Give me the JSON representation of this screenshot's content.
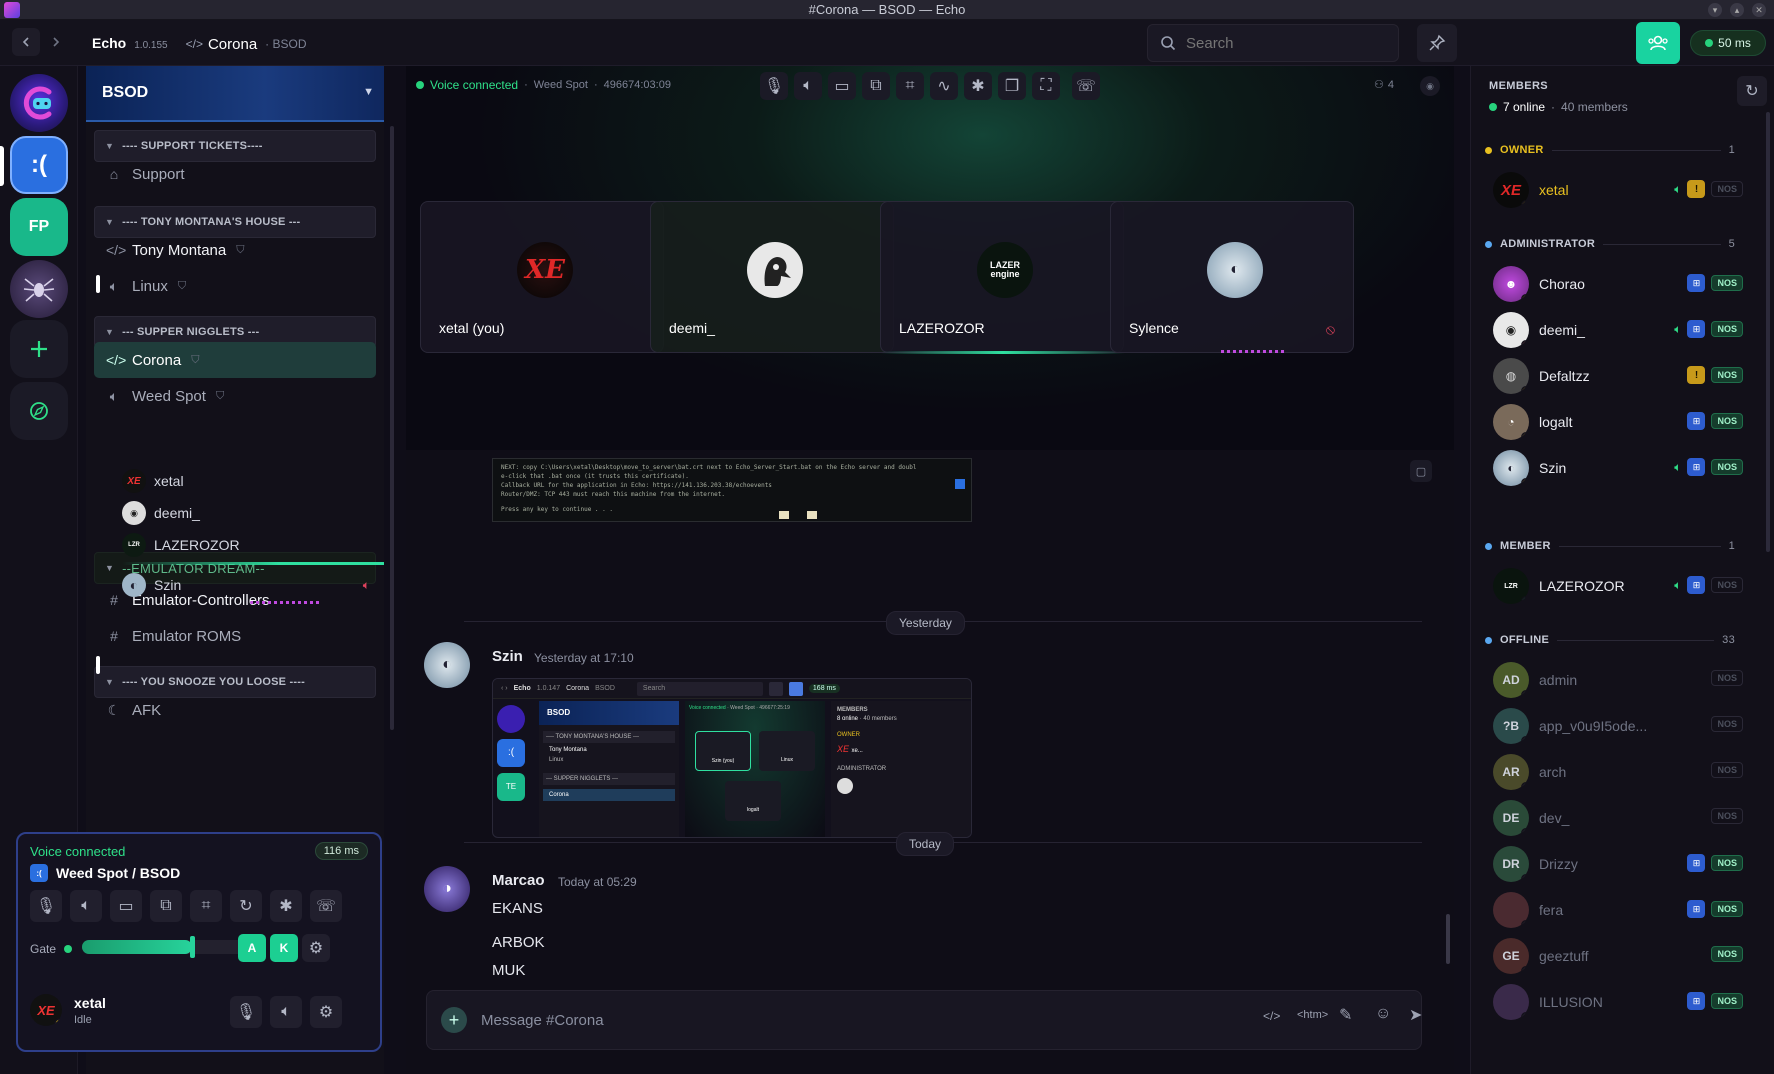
{
  "window": {
    "title": "#Corona — BSOD — Echo"
  },
  "header": {
    "app_name": "Echo",
    "version": "1.0.155",
    "channel": "Corona",
    "server": "BSOD",
    "search_placeholder": "Search",
    "ping": "50 ms"
  },
  "rail": {
    "servers": [
      ":(",
      "FP"
    ]
  },
  "server": {
    "name": "BSOD"
  },
  "channels": {
    "cat_support": "---- SUPPORT TICKETS----",
    "ch_support": "Support",
    "cat_tony": "---- TONY MONTANA'S HOUSE ---",
    "ch_tony": "Tony Montana",
    "ch_linux": "Linux",
    "cat_supper": "--- SUPPER NIGGLETS ---",
    "ch_corona": "Corona",
    "ch_weed": "Weed Spot",
    "voice_users": [
      "xetal",
      "deemi_",
      "LAZEROZOR",
      "Szin"
    ],
    "cat_emulator": "--EMULATOR DREAM--",
    "ch_emu_ctrl": "Emulator-Controllers",
    "ch_emu_roms": "Emulator ROMS",
    "cat_snooze": "---- YOU SNOOZE YOU LOOSE ----",
    "ch_afk": "AFK"
  },
  "voice_panel": {
    "status": "Voice connected",
    "ping": "116 ms",
    "channel": "Weed Spot / BSOD",
    "gate_label": "Gate",
    "gate_level": 0.62,
    "key_a": "A",
    "key_k": "K",
    "user_name": "xetal",
    "user_status": "Idle"
  },
  "stage": {
    "status": "Voice connected",
    "channel": "Weed Spot",
    "duration": "496674:03:09",
    "participants_count": "4",
    "tiles": [
      "xetal (you)",
      "deemi_",
      "LAZEROZOR",
      "Sylence"
    ],
    "lazer_logo": "LAZER engine"
  },
  "terminal_preview": {
    "lines": [
      "NEXT: copy  C:\\Users\\xetal\\Desktop\\move_to_server\\bat.crt  next to Echo_Server_Start.bat on the Echo server and doubl",
      "e-click that .bat once (it trusts this certificate).",
      "  Callback URL for the application in Echo:  https://141.136.203.38/echoevents",
      "  Router/DMZ: TCP 443 must reach this machine from the internet.",
      "Press any key to continue . . ."
    ]
  },
  "messages": {
    "day_yesterday": "Yesterday",
    "day_today": "Today",
    "m1_author": "Szin",
    "m1_time": "Yesterday at 17:10",
    "m2_author": "Marcao",
    "m2_time": "Today at 05:29",
    "m2_lines": [
      "EKANS",
      "ARBOK",
      "MUK"
    ]
  },
  "composer": {
    "placeholder": "Message #Corona",
    "code_label": "</>",
    "htm_label": "<htm>"
  },
  "members": {
    "title": "MEMBERS",
    "online": "7 online",
    "total": "40 members",
    "groups": {
      "owner": {
        "label": "OWNER",
        "count": "1"
      },
      "admin": {
        "label": "ADMINISTRATOR",
        "count": "5"
      },
      "member": {
        "label": "MEMBER",
        "count": "1"
      },
      "offline": {
        "label": "OFFLINE",
        "count": "33"
      }
    },
    "owner_name": "xetal",
    "admin_names": [
      "Chorao",
      "deemi_",
      "Defaltzz",
      "logalt",
      "Szin"
    ],
    "member_names": [
      "LAZEROZOR"
    ],
    "offline": [
      {
        "name": "admin",
        "initials": "AD",
        "color": "#4a5a2a"
      },
      {
        "name": "app_v0u9I5ode...",
        "initials": "?B",
        "color": "#2a4a4a"
      },
      {
        "name": "arch",
        "initials": "AR",
        "color": "#4a4a2a"
      },
      {
        "name": "dev_",
        "initials": "DE",
        "color": "#2a4a38"
      },
      {
        "name": "Drizzy",
        "initials": "DR",
        "color": "#2a4a3a"
      },
      {
        "name": "fera",
        "initials": "",
        "color": "#4a2a30"
      },
      {
        "name": "geeztuff",
        "initials": "GE",
        "color": "#4a2a2a"
      },
      {
        "name": "ILLUSION",
        "initials": "",
        "color": "#3a2a4a"
      }
    ],
    "nos": "NOS",
    "warn": "!"
  },
  "screenshot_thumb": {
    "app": "Echo",
    "ver": "1.0.147",
    "chan": "Corona",
    "srv": "BSOD",
    "search": "Search",
    "ping": "168 ms",
    "server": "BSOD",
    "cat1": "---- TONY MONTANA'S HOUSE ---",
    "ch1": "Tony Montana",
    "ch2": "Linux",
    "cat2": "--- SUPPER NIGGLETS ---",
    "ch3": "Corona",
    "vc": "Voice connected",
    "vcs": "Weed Spot",
    "vcd": "496677:25:19",
    "tile1": "Szin (you)",
    "tile2": "Linux",
    "tile3": "logalt",
    "members": "MEMBERS",
    "online": "8 online",
    "total": "40 members",
    "owner": "OWNER",
    "admin": "ADMINISTRATOR",
    "te": "TE"
  },
  "colors": {
    "accent": "#19d3a0",
    "online": "#27d37d",
    "voice_green": "#2fe089",
    "nos_bg": "#153c2c",
    "win_badge": "#2d5ccf",
    "warn_badge": "#c79a1a"
  }
}
